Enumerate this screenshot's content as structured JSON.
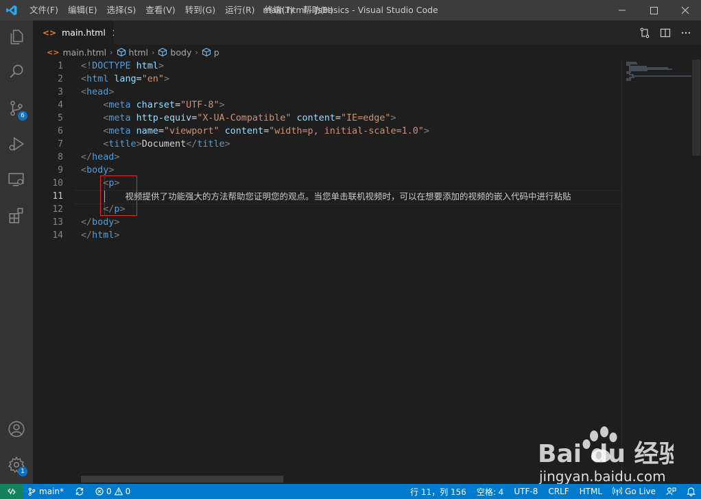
{
  "window": {
    "title": "main.html - JsBasics - Visual Studio Code",
    "menu": [
      "文件(F)",
      "编辑(E)",
      "选择(S)",
      "查看(V)",
      "转到(G)",
      "运行(R)",
      "终端(T)",
      "帮助(H)"
    ]
  },
  "activity_bar": {
    "icons": [
      "explorer-icon",
      "search-icon",
      "source-control-icon",
      "run-debug-icon",
      "remote-explorer-icon",
      "extensions-icon",
      "account-icon",
      "manage-gear-icon"
    ],
    "source_control_badge": "6",
    "manage_badge": "1"
  },
  "tab": {
    "label": "main.html"
  },
  "breadcrumb": [
    "main.html",
    "html",
    "body",
    "p"
  ],
  "editor": {
    "line_numbers": [
      "1",
      "2",
      "3",
      "4",
      "5",
      "6",
      "7",
      "8",
      "9",
      "10",
      "11",
      "12",
      "13",
      "14"
    ],
    "active_line": "11",
    "lines": [
      [
        [
          "dt",
          "<!"
        ],
        [
          "tg",
          "DOCTYPE"
        ],
        [
          "tx",
          " "
        ],
        [
          "at",
          "html"
        ],
        [
          "dt",
          ">"
        ]
      ],
      [
        [
          "dt",
          "<"
        ],
        [
          "tg",
          "html"
        ],
        [
          "tx",
          " "
        ],
        [
          "at",
          "lang"
        ],
        [
          "tx",
          "="
        ],
        [
          "st",
          "\"en\""
        ],
        [
          "dt",
          ">"
        ]
      ],
      [
        [
          "dt",
          "<"
        ],
        [
          "tg",
          "head"
        ],
        [
          "dt",
          ">"
        ]
      ],
      [
        [
          "tx",
          "    "
        ],
        [
          "dt",
          "<"
        ],
        [
          "tg",
          "meta"
        ],
        [
          "tx",
          " "
        ],
        [
          "at",
          "charset"
        ],
        [
          "tx",
          "="
        ],
        [
          "st",
          "\"UTF-8\""
        ],
        [
          "dt",
          ">"
        ]
      ],
      [
        [
          "tx",
          "    "
        ],
        [
          "dt",
          "<"
        ],
        [
          "tg",
          "meta"
        ],
        [
          "tx",
          " "
        ],
        [
          "at",
          "http-equiv"
        ],
        [
          "tx",
          "="
        ],
        [
          "st",
          "\"X-UA-Compatible\""
        ],
        [
          "tx",
          " "
        ],
        [
          "at",
          "content"
        ],
        [
          "tx",
          "="
        ],
        [
          "st",
          "\"IE=edge\""
        ],
        [
          "dt",
          ">"
        ]
      ],
      [
        [
          "tx",
          "    "
        ],
        [
          "dt",
          "<"
        ],
        [
          "tg",
          "meta"
        ],
        [
          "tx",
          " "
        ],
        [
          "at",
          "name"
        ],
        [
          "tx",
          "="
        ],
        [
          "st",
          "\"viewport\""
        ],
        [
          "tx",
          " "
        ],
        [
          "at",
          "content"
        ],
        [
          "tx",
          "="
        ],
        [
          "st",
          "\"width=p, initial-scale=1.0\""
        ],
        [
          "dt",
          ">"
        ]
      ],
      [
        [
          "tx",
          "    "
        ],
        [
          "dt",
          "<"
        ],
        [
          "tg",
          "title"
        ],
        [
          "dt",
          ">"
        ],
        [
          "tx",
          "Document"
        ],
        [
          "dt",
          "</"
        ],
        [
          "tg",
          "title"
        ],
        [
          "dt",
          ">"
        ]
      ],
      [
        [
          "dt",
          "</"
        ],
        [
          "tg",
          "head"
        ],
        [
          "dt",
          ">"
        ]
      ],
      [
        [
          "dt",
          "<"
        ],
        [
          "tg",
          "body"
        ],
        [
          "dt",
          ">"
        ]
      ],
      [
        [
          "tx",
          "    "
        ],
        [
          "dt",
          "<"
        ],
        [
          "tg",
          "p"
        ],
        [
          "dt",
          ">"
        ]
      ],
      [
        [
          "tx",
          "        "
        ],
        [
          "zh",
          "视频提供了功能强大的方法帮助您证明您的观点。当您单击联机视频时，可以在想要添加的视频的嵌入代码中进行粘贴"
        ]
      ],
      [
        [
          "tx",
          "    "
        ],
        [
          "dt",
          "</"
        ],
        [
          "tg",
          "p"
        ],
        [
          "dt",
          ">"
        ]
      ],
      [
        [
          "dt",
          "</"
        ],
        [
          "tg",
          "body"
        ],
        [
          "dt",
          ">"
        ]
      ],
      [
        [
          "dt",
          "</"
        ],
        [
          "tg",
          "html"
        ],
        [
          "dt",
          ">"
        ]
      ]
    ]
  },
  "statusbar": {
    "branch": "main*",
    "errors": "0",
    "warnings": "0",
    "position": "行 11，列 156",
    "indent": "空格: 4",
    "encoding": "UTF-8",
    "eol": "CRLF",
    "language": "HTML",
    "go_live": "Go Live"
  },
  "watermark": {
    "brand": "Bai du 经验",
    "url": "jingyan.baidu.com"
  },
  "colors": {
    "titlebar": "#3c3c3c",
    "activity_bar": "#333333",
    "editor_bg": "#1e1e1e",
    "statusbar": "#007acc",
    "badge": "#0e70c0",
    "highlight_box": "#e02d2d",
    "tag": "#569cd6",
    "attribute": "#9cdcfe",
    "string": "#ce9178"
  }
}
